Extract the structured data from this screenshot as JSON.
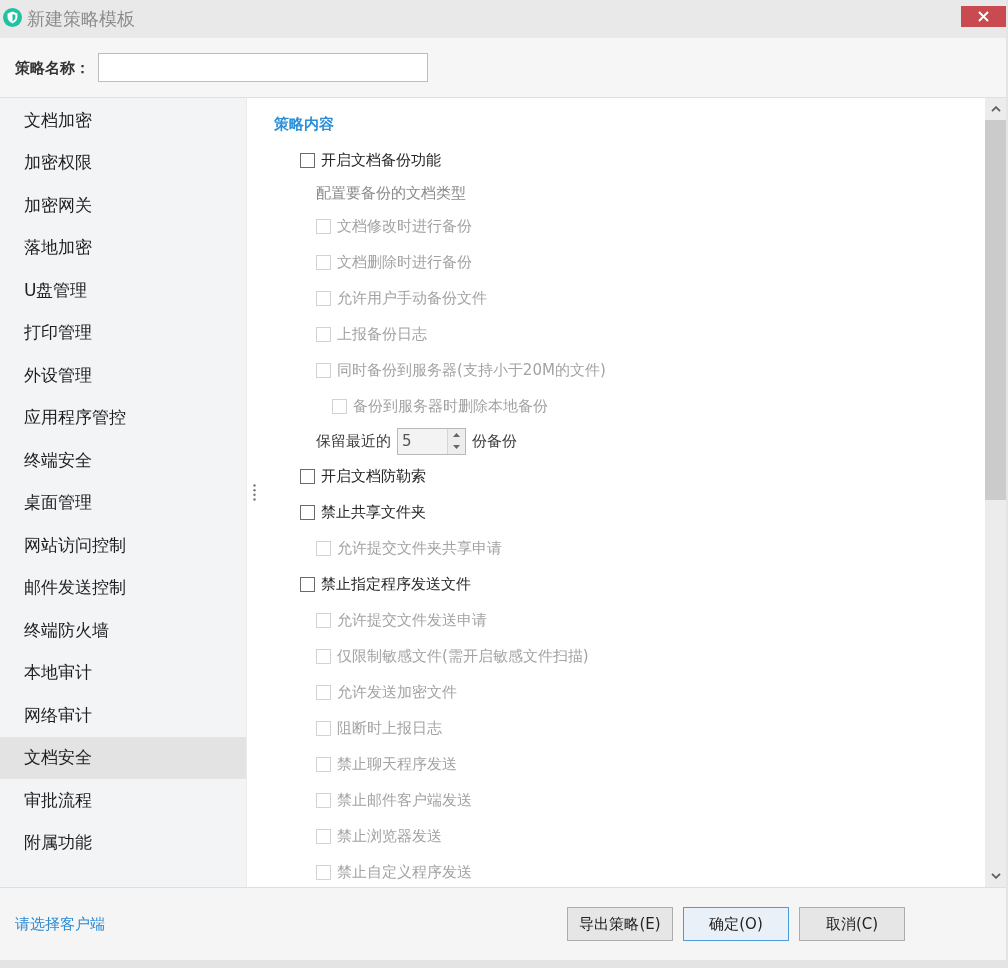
{
  "window": {
    "title": "新建策略模板"
  },
  "name_field": {
    "label": "策略名称："
  },
  "sidebar": {
    "items": [
      {
        "label": "文档加密",
        "selected": false
      },
      {
        "label": "加密权限",
        "selected": false
      },
      {
        "label": "加密网关",
        "selected": false
      },
      {
        "label": "落地加密",
        "selected": false
      },
      {
        "label": "U盘管理",
        "selected": false
      },
      {
        "label": "打印管理",
        "selected": false
      },
      {
        "label": "外设管理",
        "selected": false
      },
      {
        "label": "应用程序管控",
        "selected": false
      },
      {
        "label": "终端安全",
        "selected": false
      },
      {
        "label": "桌面管理",
        "selected": false
      },
      {
        "label": "网站访问控制",
        "selected": false
      },
      {
        "label": "邮件发送控制",
        "selected": false
      },
      {
        "label": "终端防火墙",
        "selected": false
      },
      {
        "label": "本地审计",
        "selected": false
      },
      {
        "label": "网络审计",
        "selected": false
      },
      {
        "label": "文档安全",
        "selected": true
      },
      {
        "label": "审批流程",
        "selected": false
      },
      {
        "label": "附属功能",
        "selected": false
      }
    ]
  },
  "content": {
    "heading": "策略内容",
    "items": [
      {
        "kind": "checkbox",
        "label": "开启文档备份功能",
        "checked": false,
        "disabled": false,
        "children": [
          {
            "kind": "caption",
            "label": "配置要备份的文档类型"
          },
          {
            "kind": "checkbox",
            "label": "文档修改时进行备份",
            "checked": false,
            "disabled": true
          },
          {
            "kind": "checkbox",
            "label": "文档删除时进行备份",
            "checked": false,
            "disabled": true
          },
          {
            "kind": "checkbox",
            "label": "允许用户手动备份文件",
            "checked": false,
            "disabled": true
          },
          {
            "kind": "checkbox",
            "label": "上报备份日志",
            "checked": false,
            "disabled": true
          },
          {
            "kind": "checkbox",
            "label": "同时备份到服务器(支持小于20M的文件)",
            "checked": false,
            "disabled": true,
            "children": [
              {
                "kind": "checkbox",
                "label": "备份到服务器时删除本地备份",
                "checked": false,
                "disabled": true
              }
            ]
          },
          {
            "kind": "spinner",
            "label": "保留最近的",
            "value": "5",
            "unit": "份备份"
          }
        ]
      },
      {
        "kind": "checkbox",
        "label": "开启文档防勒索",
        "checked": false,
        "disabled": false
      },
      {
        "kind": "checkbox",
        "label": "禁止共享文件夹",
        "checked": false,
        "disabled": false,
        "children": [
          {
            "kind": "checkbox",
            "label": "允许提交文件夹共享申请",
            "checked": false,
            "disabled": true
          }
        ]
      },
      {
        "kind": "checkbox",
        "label": "禁止指定程序发送文件",
        "checked": false,
        "disabled": false,
        "children": [
          {
            "kind": "checkbox",
            "label": "允许提交文件发送申请",
            "checked": false,
            "disabled": true
          },
          {
            "kind": "checkbox",
            "label": "仅限制敏感文件(需开启敏感文件扫描)",
            "checked": false,
            "disabled": true
          },
          {
            "kind": "checkbox",
            "label": "允许发送加密文件",
            "checked": false,
            "disabled": true
          },
          {
            "kind": "checkbox",
            "label": "阻断时上报日志",
            "checked": false,
            "disabled": true
          },
          {
            "kind": "checkbox",
            "label": "禁止聊天程序发送",
            "checked": false,
            "disabled": true
          },
          {
            "kind": "checkbox",
            "label": "禁止邮件客户端发送",
            "checked": false,
            "disabled": true
          },
          {
            "kind": "checkbox",
            "label": "禁止浏览器发送",
            "checked": false,
            "disabled": true
          },
          {
            "kind": "checkbox",
            "label": "禁止自定义程序发送",
            "checked": false,
            "disabled": true
          }
        ]
      }
    ]
  },
  "footer": {
    "link": "请选择客户端",
    "buttons": [
      {
        "label": "导出策略(E)",
        "default": false
      },
      {
        "label": "确定(O)",
        "default": true
      },
      {
        "label": "取消(C)",
        "default": false
      }
    ]
  }
}
